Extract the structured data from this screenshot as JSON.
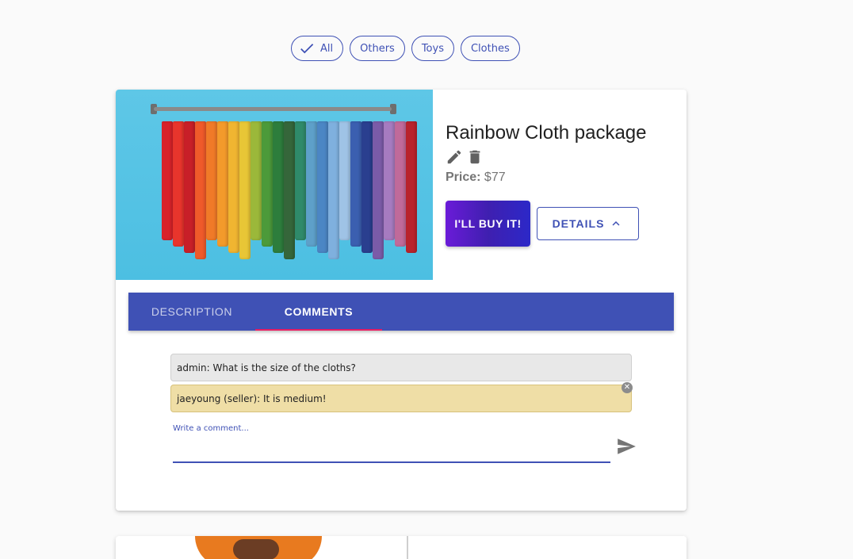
{
  "filters": {
    "chips": [
      {
        "label": "All",
        "selected": true
      },
      {
        "label": "Others",
        "selected": false
      },
      {
        "label": "Toys",
        "selected": false
      },
      {
        "label": "Clothes",
        "selected": false
      }
    ]
  },
  "product": {
    "title": "Rainbow Cloth package",
    "price_label": "Price:",
    "price_value": "$77",
    "buy_label": "I'LL BUY IT!",
    "details_label": "DETAILS",
    "image_icon": "clothes-rack-photo"
  },
  "tabs": [
    {
      "label": "DESCRIPTION",
      "active": false
    },
    {
      "label": "COMMENTS",
      "active": true
    }
  ],
  "comments": [
    {
      "text": "admin: What is the size of the cloths?",
      "type": "admin"
    },
    {
      "text": "jaeyoung (seller): It is medium!",
      "type": "seller"
    }
  ],
  "comment_input": {
    "label": "Write a comment...",
    "value": ""
  },
  "colors": {
    "primary": "#3f51b5",
    "tab_indicator": "#e91e63",
    "seller_comment_bg": "#efdea6",
    "admin_comment_bg": "#e8e8e8"
  },
  "icons": {
    "check": "check-icon",
    "edit": "edit-icon",
    "delete": "trash-icon",
    "expand": "chevron-up-icon",
    "remove": "close-circle-icon",
    "send": "send-icon"
  }
}
